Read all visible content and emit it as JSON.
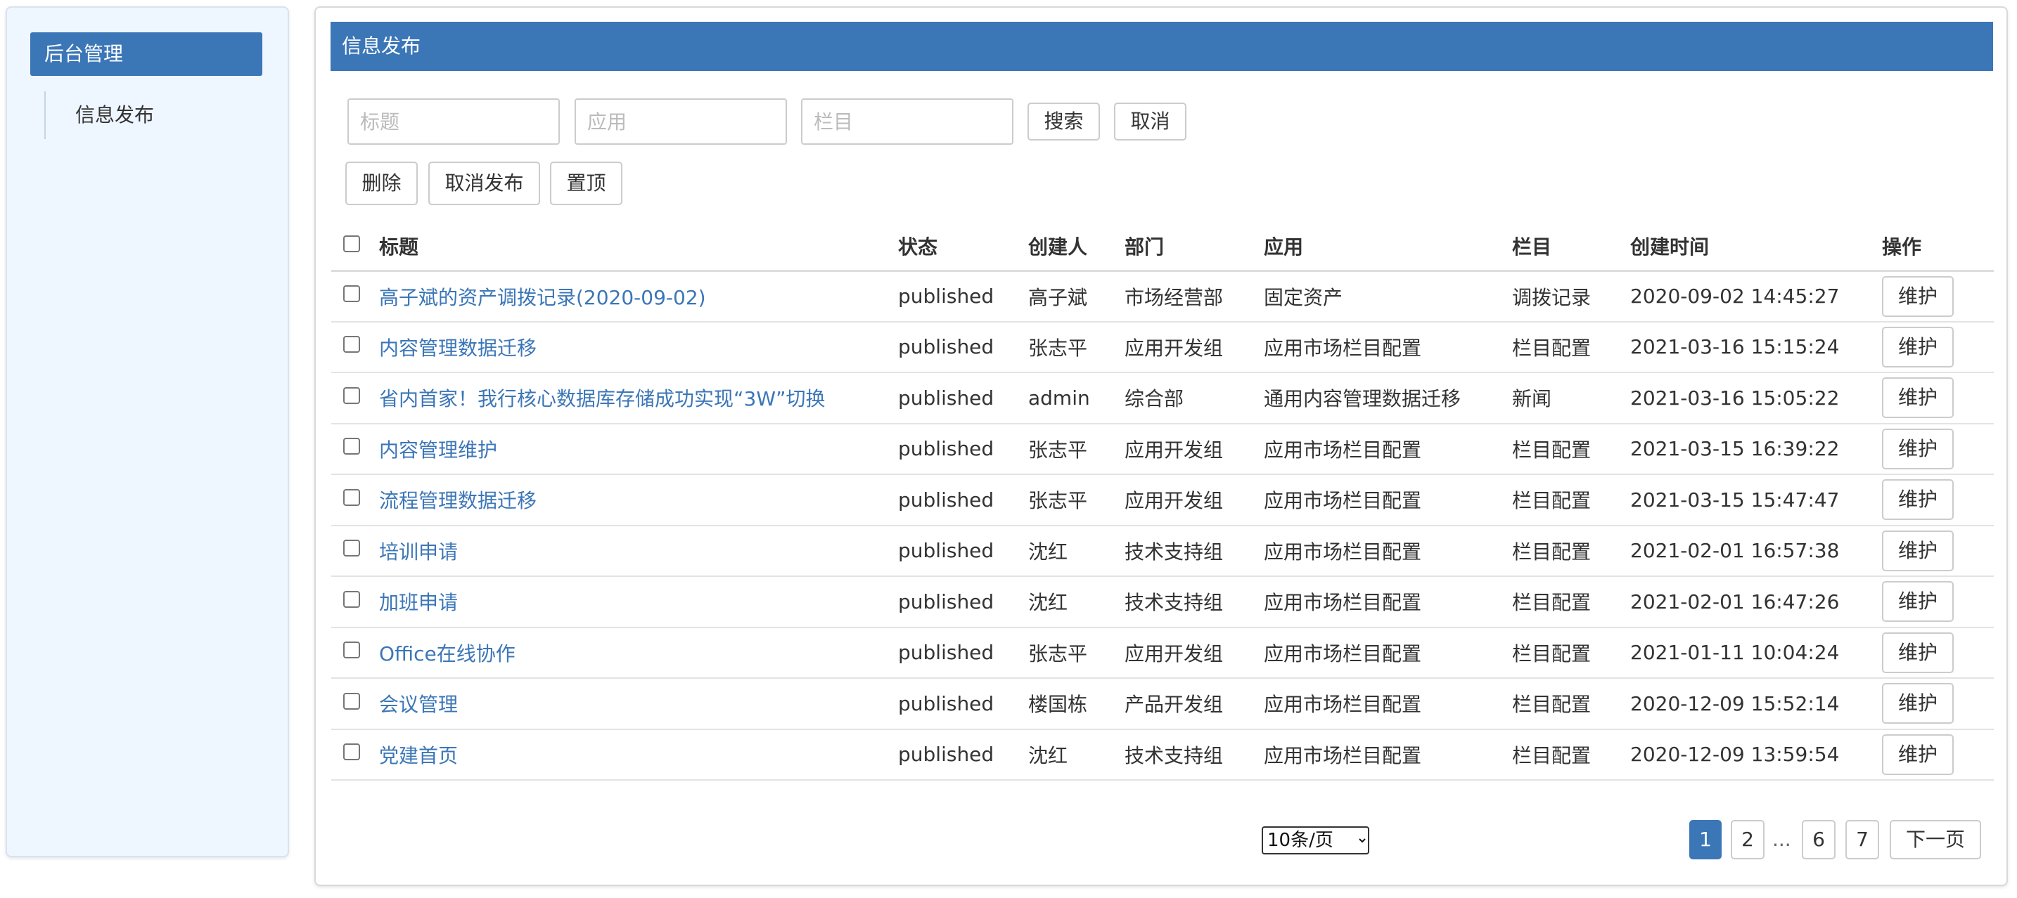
{
  "sidebar": {
    "title": "后台管理",
    "items": [
      {
        "label": "信息发布"
      }
    ]
  },
  "main": {
    "header": "信息发布",
    "filters": {
      "title_placeholder": "标题",
      "app_placeholder": "应用",
      "column_placeholder": "栏目",
      "search_label": "搜索",
      "cancel_label": "取消"
    },
    "actions": {
      "delete_label": "删除",
      "unpublish_label": "取消发布",
      "pin_label": "置顶"
    },
    "table": {
      "columns": [
        "标题",
        "状态",
        "创建人",
        "部门",
        "应用",
        "栏目",
        "创建时间",
        "操作"
      ],
      "rows": [
        {
          "title": "高子斌的资产调拨记录(2020-09-02)",
          "status": "published",
          "creator": "高子斌",
          "dept": "市场经营部",
          "app": "固定资产",
          "column": "调拨记录",
          "created": "2020-09-02 14:45:27",
          "op": "维护"
        },
        {
          "title": "内容管理数据迁移",
          "status": "published",
          "creator": "张志平",
          "dept": "应用开发组",
          "app": "应用市场栏目配置",
          "column": "栏目配置",
          "created": "2021-03-16 15:15:24",
          "op": "维护"
        },
        {
          "title": "省内首家！我行核心数据库存储成功实现“3W”切换",
          "status": "published",
          "creator": "admin",
          "dept": "综合部",
          "app": "通用内容管理数据迁移",
          "column": "新闻",
          "created": "2021-03-16 15:05:22",
          "op": "维护"
        },
        {
          "title": "内容管理维护",
          "status": "published",
          "creator": "张志平",
          "dept": "应用开发组",
          "app": "应用市场栏目配置",
          "column": "栏目配置",
          "created": "2021-03-15 16:39:22",
          "op": "维护"
        },
        {
          "title": "流程管理数据迁移",
          "status": "published",
          "creator": "张志平",
          "dept": "应用开发组",
          "app": "应用市场栏目配置",
          "column": "栏目配置",
          "created": "2021-03-15 15:47:47",
          "op": "维护"
        },
        {
          "title": "培训申请",
          "status": "published",
          "creator": "沈红",
          "dept": "技术支持组",
          "app": "应用市场栏目配置",
          "column": "栏目配置",
          "created": "2021-02-01 16:57:38",
          "op": "维护"
        },
        {
          "title": "加班申请",
          "status": "published",
          "creator": "沈红",
          "dept": "技术支持组",
          "app": "应用市场栏目配置",
          "column": "栏目配置",
          "created": "2021-02-01 16:47:26",
          "op": "维护"
        },
        {
          "title": "Office在线协作",
          "status": "published",
          "creator": "张志平",
          "dept": "应用开发组",
          "app": "应用市场栏目配置",
          "column": "栏目配置",
          "created": "2021-01-11 10:04:24",
          "op": "维护"
        },
        {
          "title": "会议管理",
          "status": "published",
          "creator": "楼国栋",
          "dept": "产品开发组",
          "app": "应用市场栏目配置",
          "column": "栏目配置",
          "created": "2020-12-09 15:52:14",
          "op": "维护"
        },
        {
          "title": "党建首页",
          "status": "published",
          "creator": "沈红",
          "dept": "技术支持组",
          "app": "应用市场栏目配置",
          "column": "栏目配置",
          "created": "2020-12-09 13:59:54",
          "op": "维护"
        }
      ]
    },
    "pagination": {
      "page_size": "10条/页",
      "pages": [
        "1",
        "2",
        "...",
        "6",
        "7"
      ],
      "current": "1",
      "next_label": "下一页"
    }
  },
  "colors": {
    "accent": "#3b76b7",
    "sidebar_bg": "#eef6ff",
    "link": "#3b76b7",
    "border": "#cccccc"
  }
}
